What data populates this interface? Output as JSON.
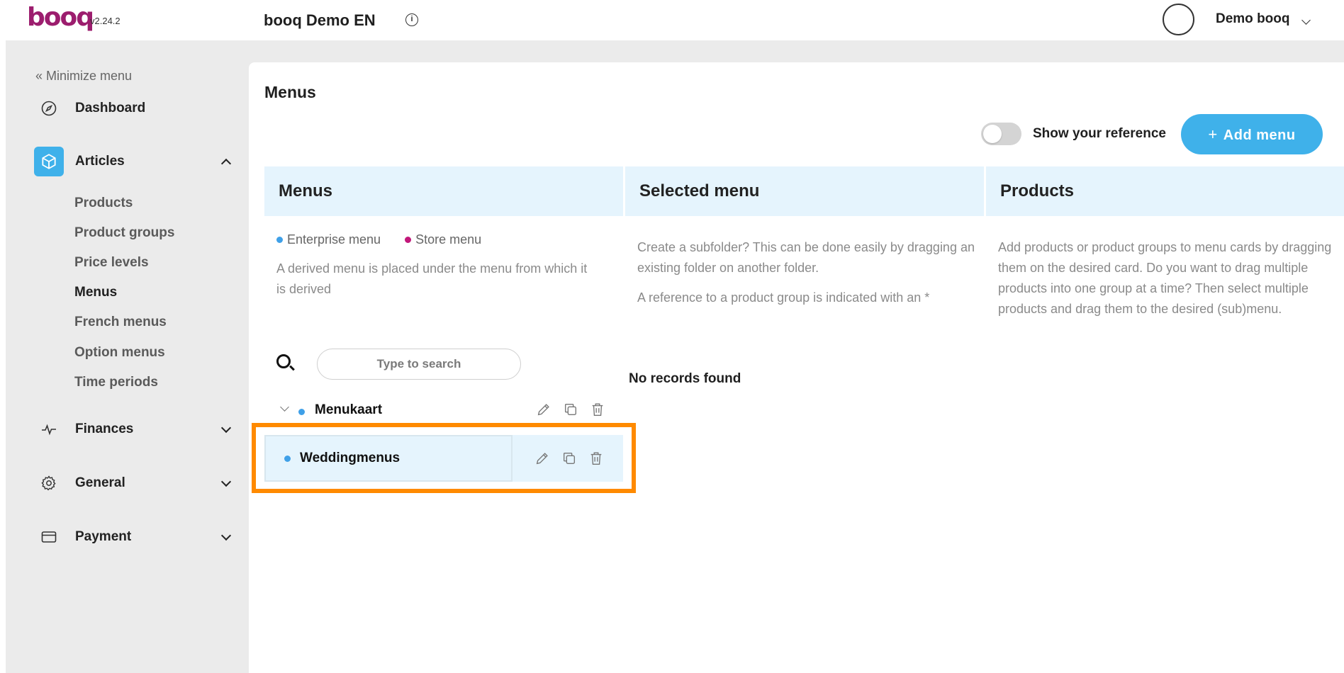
{
  "app": {
    "logo_text": "booq",
    "version": "v2.24.2",
    "venue_name": "booq Demo EN",
    "user_name": "Demo booq"
  },
  "sidebar": {
    "minimize_label": "« Minimize menu",
    "items": [
      {
        "label": "Dashboard",
        "icon": "compass-icon"
      },
      {
        "label": "Articles",
        "icon": "cube-icon",
        "active": true,
        "expanded": true
      },
      {
        "label": "Finances",
        "icon": "pulse-icon"
      },
      {
        "label": "General",
        "icon": "gear-icon"
      },
      {
        "label": "Payment",
        "icon": "card-icon"
      }
    ],
    "sub_items": [
      "Products",
      "Product groups",
      "Price levels",
      "Menus",
      "French menus",
      "Option menus",
      "Time periods"
    ],
    "active_sub_item": "Menus"
  },
  "main": {
    "title": "Menus",
    "toggle_label": "Show your reference",
    "toggle_on": false,
    "add_menu_label": "Add menu",
    "columns": [
      "Menus",
      "Selected menu",
      "Products"
    ],
    "legend": {
      "enterprise": "Enterprise menu",
      "store": "Store menu"
    },
    "menus_help": "A derived menu is placed under the menu from which it is derived",
    "selected_help_1": "Create a subfolder? This can be done easily by dragging an existing folder on another folder.",
    "selected_help_2": "A reference to a product group is indicated with an *",
    "products_help": "Add products or product groups to menu cards by dragging them on the desired card. Do you want to drag multiple products into one group at a time? Then select multiple products and drag them to the desired (sub)menu.",
    "search_placeholder": "Type to search",
    "no_records": "No records found",
    "tree": [
      {
        "label": "Menukaart",
        "expanded": true
      },
      {
        "label": "Weddingmenus",
        "selected": true
      }
    ]
  },
  "colors": {
    "accent": "#3fb1ea",
    "brand": "#9c1d6e",
    "highlight": "#ff8a00",
    "enterprise_dot": "#3fa0e8",
    "store_dot": "#c2177a"
  }
}
